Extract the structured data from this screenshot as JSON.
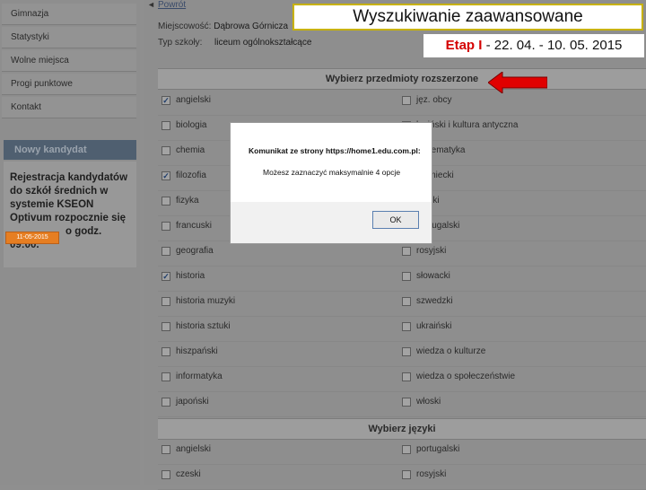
{
  "header": {
    "title": "Wyszukiwanie zaawansowane",
    "stage_label": "Etap I",
    "stage_dates": " - 22. 04. - 10. 05. 2015",
    "back_link": "Powrót"
  },
  "sidebar": {
    "items": [
      {
        "label": "Gimnazja"
      },
      {
        "label": "Statystyki"
      },
      {
        "label": "Wolne miejsca"
      },
      {
        "label": "Progi punktowe"
      },
      {
        "label": "Kontakt"
      }
    ],
    "new_candidate": "Nowy kandydat",
    "candidate_text_1": "Rejestracja kandydatów do szkół średnich w systemie KSEON Optivum rozpocznie się",
    "candidate_text_2": "o godz.",
    "candidate_time": "09:00.",
    "date_badge": "11-05-2015"
  },
  "info": {
    "city_label": "Miejscowość:",
    "city_value": "Dąbrowa Górnicza",
    "type_label": "Typ szkoły:",
    "type_value": "liceum ogólnokształcące"
  },
  "extended": {
    "heading": "Wybierz przedmioty rozszerzone",
    "left": [
      {
        "label": "angielski",
        "checked": true
      },
      {
        "label": "biologia",
        "checked": false
      },
      {
        "label": "chemia",
        "checked": false
      },
      {
        "label": "filozofia",
        "checked": true
      },
      {
        "label": "fizyka",
        "checked": false
      },
      {
        "label": "francuski",
        "checked": false
      },
      {
        "label": "geografia",
        "checked": false
      },
      {
        "label": "historia",
        "checked": true
      },
      {
        "label": "historia muzyki",
        "checked": false
      },
      {
        "label": "historia sztuki",
        "checked": false
      },
      {
        "label": "hiszpański",
        "checked": false
      },
      {
        "label": "informatyka",
        "checked": false
      },
      {
        "label": "japoński",
        "checked": false
      }
    ],
    "right": [
      {
        "label": "jęz. obcy",
        "checked": false
      },
      {
        "label": "łaciński i kultura antyczna",
        "checked": false
      },
      {
        "label": "matematyka",
        "checked": false
      },
      {
        "label": "niemiecki",
        "checked": false
      },
      {
        "label": "polski",
        "checked": false
      },
      {
        "label": "portugalski",
        "checked": false
      },
      {
        "label": "rosyjski",
        "checked": false
      },
      {
        "label": "słowacki",
        "checked": false
      },
      {
        "label": "szwedzki",
        "checked": false
      },
      {
        "label": "ukraiński",
        "checked": false
      },
      {
        "label": "wiedza o kulturze",
        "checked": false
      },
      {
        "label": "wiedza o społeczeństwie",
        "checked": false
      },
      {
        "label": "włoski",
        "checked": false
      }
    ]
  },
  "languages": {
    "heading": "Wybierz języki",
    "left": [
      {
        "label": "angielski",
        "checked": false
      },
      {
        "label": "czeski",
        "checked": false
      }
    ],
    "right": [
      {
        "label": "portugalski",
        "checked": false
      },
      {
        "label": "rosyjski",
        "checked": false
      }
    ]
  },
  "dialog": {
    "title": "Komunikat ze strony https://home1.edu.com.pl:",
    "message": "Możesz zaznaczyć maksymalnie 4 opcje",
    "ok_label": "OK"
  },
  "colors": {
    "title_border": "#c8b200",
    "stage_red": "#d40000",
    "arrow": "#e00000",
    "badge": "#e67e22"
  }
}
